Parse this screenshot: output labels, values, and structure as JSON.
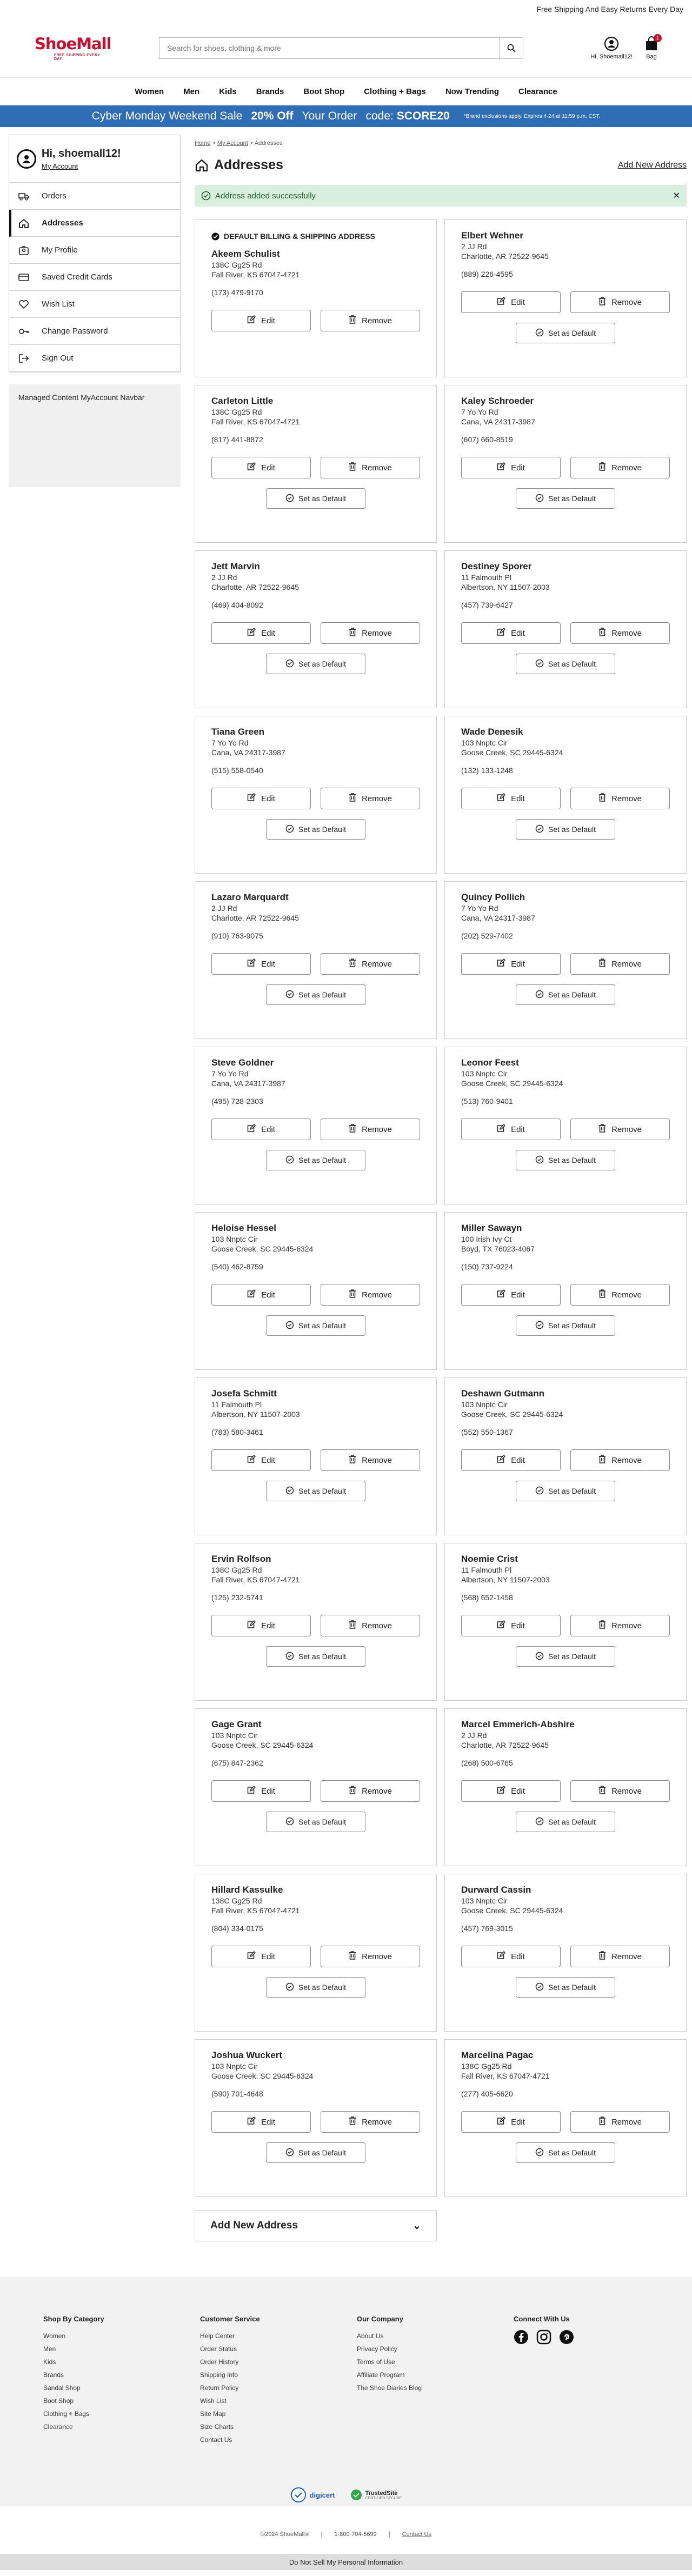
{
  "topbar": {
    "text": "Free Shipping And Easy Returns Every Day"
  },
  "logo": {
    "text": "ShoeMall",
    "tagline": "FREE SHIPPING EVERY DAY"
  },
  "search": {
    "placeholder": "Search for shoes, clothing & more"
  },
  "header": {
    "account_label": "Hi, Shoemall12!",
    "bag_label": "Bag",
    "bag_count": "1"
  },
  "nav": [
    "Women",
    "Men",
    "Kids",
    "Brands",
    "Boot Shop",
    "Clothing + Bags",
    "Now Trending",
    "Clearance"
  ],
  "promo": {
    "part1": "Cyber Monday Weekend Sale",
    "part2": "20% Off",
    "part3": "Your Order",
    "part4": "code:",
    "code": "SCORE20",
    "fine": "*Brand exclusions apply. Expires 4-24 at 11:59 p.m. CST."
  },
  "sidebar": {
    "greeting": "Hi, shoemall12!",
    "my_account": "My Account",
    "items": [
      "Orders",
      "Addresses",
      "My Profile",
      "Saved Credit Cards",
      "Wish List",
      "Change Password",
      "Sign Out"
    ],
    "managed": "Managed Content MyAccount Navbar"
  },
  "breadcrumb": {
    "home": "Home",
    "account": "My Account",
    "current": "Addresses"
  },
  "page": {
    "title": "Addresses",
    "add_new": "Add New Address"
  },
  "alert": {
    "text": "Address added successfully"
  },
  "default_label": "DEFAULT BILLING & SHIPPING ADDRESS",
  "buttons": {
    "edit": "Edit",
    "remove": "Remove",
    "set_default": "Set as Default"
  },
  "addresses": [
    {
      "name": "Akeem Schulist",
      "line1": "138C Gg25 Rd",
      "line2": "Fall River, KS 67047-4721",
      "phone": "(173) 479-9170"
    },
    {
      "name": "Elbert Wehner",
      "line1": "2 JJ Rd",
      "line2": "Charlotte, AR 72522-9645",
      "phone": "(889) 226-4595"
    },
    {
      "name": "Carleton Little",
      "line1": "138C Gg25 Rd",
      "line2": "Fall River, KS 67047-4721",
      "phone": "(817) 441-8872"
    },
    {
      "name": "Kaley Schroeder",
      "line1": "7 Yo Yo Rd",
      "line2": "Cana, VA 24317-3987",
      "phone": "(607) 660-8519"
    },
    {
      "name": "Jett Marvin",
      "line1": "2 JJ Rd",
      "line2": "Charlotte, AR 72522-9645",
      "phone": "(469) 404-8092"
    },
    {
      "name": "Destiney Sporer",
      "line1": "11 Falmouth Pl",
      "line2": "Albertson, NY 11507-2003",
      "phone": "(457) 739-6427"
    },
    {
      "name": "Tiana Green",
      "line1": "7 Yo Yo Rd",
      "line2": "Cana, VA 24317-3987",
      "phone": "(515) 558-0540"
    },
    {
      "name": "Wade Denesik",
      "line1": "103 Nnptc Cir",
      "line2": "Goose Creek, SC 29445-6324",
      "phone": "(132) 133-1248"
    },
    {
      "name": "Lazaro Marquardt",
      "line1": "2 JJ Rd",
      "line2": "Charlotte, AR 72522-9645",
      "phone": "(910) 763-9075"
    },
    {
      "name": "Quincy Pollich",
      "line1": "7 Yo Yo Rd",
      "line2": "Cana, VA 24317-3987",
      "phone": "(202) 529-7402"
    },
    {
      "name": "Steve Goldner",
      "line1": "7 Yo Yo Rd",
      "line2": "Cana, VA 24317-3987",
      "phone": "(495) 728-2303"
    },
    {
      "name": "Leonor Feest",
      "line1": "103 Nnptc Cir",
      "line2": "Goose Creek, SC 29445-6324",
      "phone": "(513) 760-9401"
    },
    {
      "name": "Heloise Hessel",
      "line1": "103 Nnptc Cir",
      "line2": "Goose Creek, SC 29445-6324",
      "phone": "(540) 462-8759"
    },
    {
      "name": "Miller Sawayn",
      "line1": "100 Irish Ivy Ct",
      "line2": "Boyd, TX 76023-4067",
      "phone": "(150) 737-9224"
    },
    {
      "name": "Josefa Schmitt",
      "line1": "11 Falmouth Pl",
      "line2": "Albertson, NY 11507-2003",
      "phone": "(783) 580-3461"
    },
    {
      "name": "Deshawn Gutmann",
      "line1": "103 Nnptc Cir",
      "line2": "Goose Creek, SC 29445-6324",
      "phone": "(552) 550-1367"
    },
    {
      "name": "Ervin Rolfson",
      "line1": "138C Gg25 Rd",
      "line2": "Fall River, KS 67047-4721",
      "phone": "(125) 232-5741"
    },
    {
      "name": "Noemie Crist",
      "line1": "11 Falmouth Pl",
      "line2": "Albertson, NY 11507-2003",
      "phone": "(568) 652-1458"
    },
    {
      "name": "Gage Grant",
      "line1": "103 Nnptc Cir",
      "line2": "Goose Creek, SC 29445-6324",
      "phone": "(675) 847-2362"
    },
    {
      "name": "Marcel Emmerich-Abshire",
      "line1": "2 JJ Rd",
      "line2": "Charlotte, AR 72522-9645",
      "phone": "(268) 500-6765"
    },
    {
      "name": "Hillard Kassulke",
      "line1": "138C Gg25 Rd",
      "line2": "Fall River, KS 67047-4721",
      "phone": "(804) 334-0175"
    },
    {
      "name": "Durward Cassin",
      "line1": "103 Nnptc Cir",
      "line2": "Goose Creek, SC 29445-6324",
      "phone": "(457) 769-3015"
    },
    {
      "name": "Joshua Wuckert",
      "line1": "103 Nnptc Cir",
      "line2": "Goose Creek, SC 29445-6324",
      "phone": "(590) 701-4648"
    },
    {
      "name": "Marcelina Pagac",
      "line1": "138C Gg25 Rd",
      "line2": "Fall River, KS 67047-4721",
      "phone": "(277) 405-6620"
    }
  ],
  "accordion": {
    "label": "Add New Address"
  },
  "footer": {
    "columns": [
      {
        "title": "Shop By Category",
        "items": [
          "Women",
          "Men",
          "Kids",
          "Brands",
          "Sandal Shop",
          "Boot Shop",
          "Clothing + Bags",
          "Clearance"
        ]
      },
      {
        "title": "Customer Service",
        "items": [
          "Help Center",
          "Order Status",
          "Order History",
          "Shipping Info",
          "Return Policy",
          "Wish List",
          "Site Map",
          "Size Charts",
          "Contact Us"
        ]
      },
      {
        "title": "Our Company",
        "items": [
          "About Us",
          "Privacy Policy",
          "Terms of Use",
          "Affiliate Program",
          "The Shoe Diaries Blog"
        ]
      },
      {
        "title": "Connect With Us",
        "items": []
      }
    ],
    "digicert": "digicert",
    "trustedsite": "TrustedSite",
    "trustedsite_sub": "CERTIFIED SECURE",
    "copyright": "©2024 ShoeMall®",
    "phone": "1-800-704-5699",
    "contact": "Contact Us",
    "dns": "Do Not Sell My Personal Information"
  },
  "colors": {
    "brand": "#c8102e",
    "promo": "#2f6eb5",
    "alert_bg": "#d9efdd"
  }
}
